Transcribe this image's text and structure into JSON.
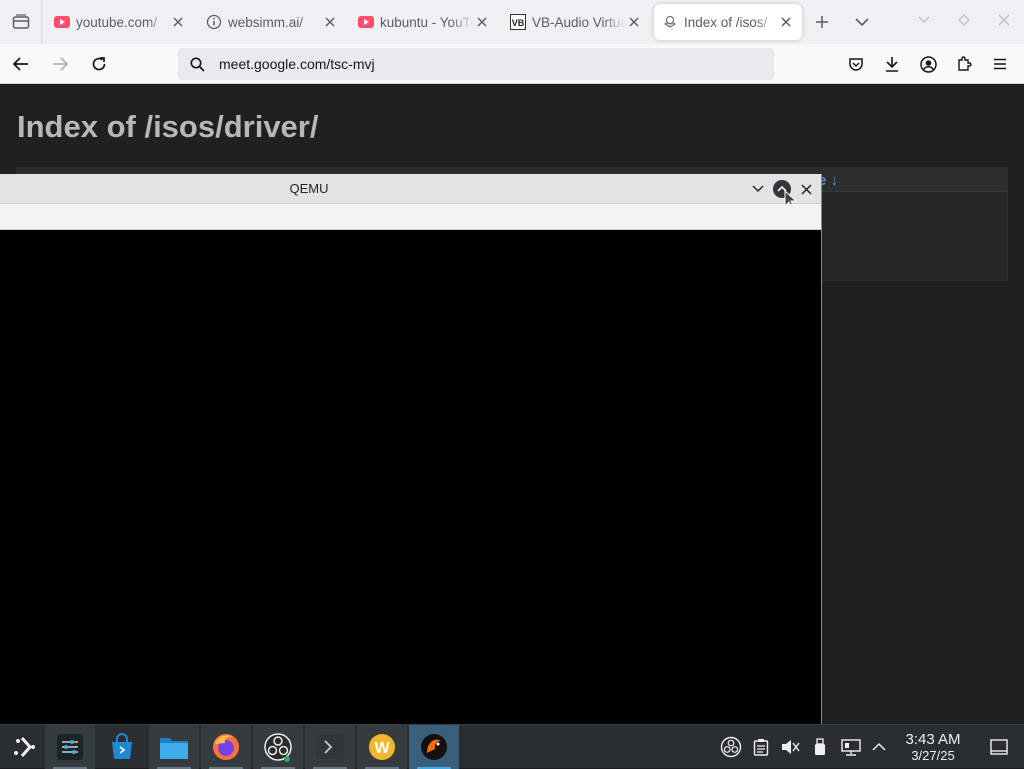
{
  "browser": {
    "tabs": [
      {
        "title": "youtube.com/",
        "icon": "youtube-icon"
      },
      {
        "title": "websimm.ai/",
        "icon": "info-icon"
      },
      {
        "title": "kubuntu - YouTube",
        "icon": "youtube-icon"
      },
      {
        "title": "VB-Audio Virtual",
        "icon": "vb-icon"
      },
      {
        "title": "Index of /isos/",
        "icon": "page-icon",
        "active": true
      }
    ],
    "url": "meet.google.com/tsc-mvj"
  },
  "page": {
    "title": "Index of /isos/driver/",
    "sort_label": "e ↓"
  },
  "qemu": {
    "title": "QEMU"
  },
  "clock": {
    "time": "3:43 AM",
    "date": "3/27/25"
  },
  "colors": {
    "accent": "#3daee9",
    "link": "#5a8fd6",
    "taskbar": "#2a2e32"
  }
}
